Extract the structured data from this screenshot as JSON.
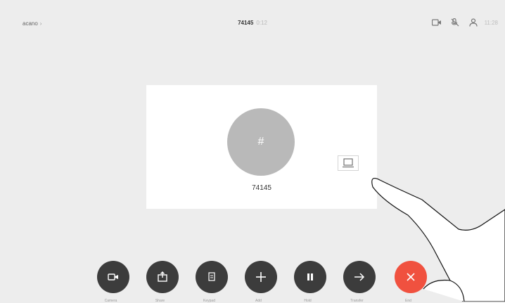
{
  "header": {
    "back_label": "acano",
    "call_number": "74145",
    "call_duration": "0:12",
    "clock": "11:28"
  },
  "status_icons": [
    "camera-icon",
    "microphone-muted-icon",
    "participants-icon"
  ],
  "call": {
    "avatar_symbol": "#",
    "participant_name": "74145"
  },
  "controls": [
    {
      "name": "camera-button",
      "icon": "video-camera-icon",
      "label": "Camera"
    },
    {
      "name": "share-button",
      "icon": "share-icon",
      "label": "Share"
    },
    {
      "name": "keypad-button",
      "icon": "keypad-icon",
      "label": "Keypad"
    },
    {
      "name": "add-button",
      "icon": "plus-icon",
      "label": "Add"
    },
    {
      "name": "hold-button",
      "icon": "pause-icon",
      "label": "Hold"
    },
    {
      "name": "transfer-button",
      "icon": "arrow-right-icon",
      "label": "Transfer"
    },
    {
      "name": "end-call-button",
      "icon": "close-icon",
      "label": "End"
    }
  ],
  "colors": {
    "end_call": "#f0513f",
    "control": "#3c3c3c",
    "avatar": "#b9b9b9"
  }
}
